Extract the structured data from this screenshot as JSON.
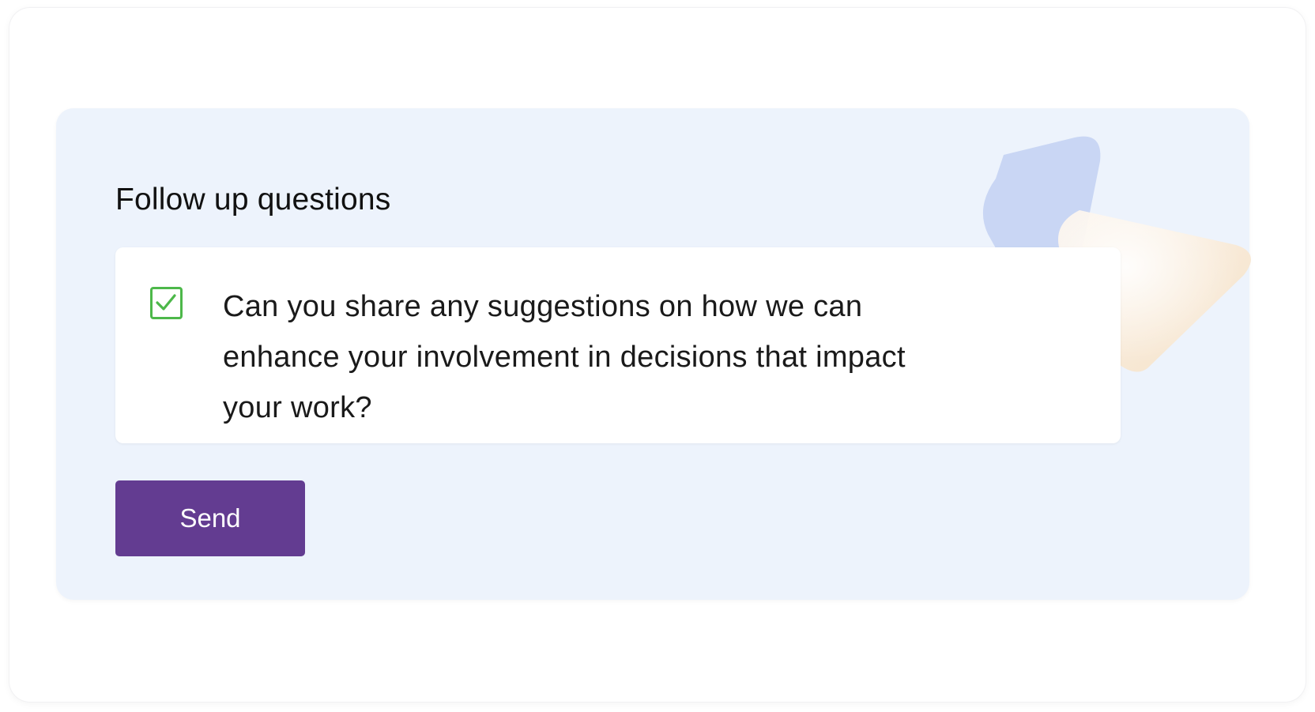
{
  "form": {
    "title": "Follow up questions",
    "question": {
      "checked": true,
      "text": "Can you share any suggestions on how we can enhance your involvement in decisions that impact your work?"
    },
    "send_label": "Send"
  },
  "colors": {
    "panel_background": "#edf3fc",
    "checkbox_green": "#4db84a",
    "button_purple": "#633c91",
    "decoration_blue": "#c9d6f4",
    "decoration_peach": "#f7e4cc"
  },
  "icons": {
    "checkbox": "check-icon"
  }
}
